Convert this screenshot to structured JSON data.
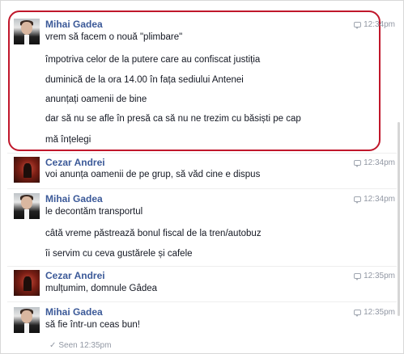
{
  "messages": [
    {
      "sender": "Mihai Gadea",
      "avatar": "mihai-gadea-avatar",
      "time": "12:34pm",
      "lines": [
        "vrem să facem o nouă \"plimbare\"",
        "împotriva celor de la putere care au confiscat justiția",
        "duminică de la ora 14.00 în fața sediului Antenei",
        "anunțați oamenii de bine",
        "dar să nu se afle în presă ca să nu ne trezim cu băsiști pe cap",
        "mă înțelegi"
      ]
    },
    {
      "sender": "Cezar Andrei",
      "avatar": "cezar-andrei-avatar",
      "time": "12:34pm",
      "lines": [
        "voi anunța oamenii de pe grup, să văd cine e dispus"
      ]
    },
    {
      "sender": "Mihai Gadea",
      "avatar": "mihai-gadea-avatar",
      "time": "12:34pm",
      "lines": [
        "le decontăm transportul",
        "câtă vreme păstrează bonul fiscal de la tren/autobuz",
        "îi servim cu ceva gustărele și cafele"
      ]
    },
    {
      "sender": "Cezar Andrei",
      "avatar": "cezar-andrei-avatar",
      "time": "12:35pm",
      "lines": [
        "mulțumim, domnule Gâdea"
      ]
    },
    {
      "sender": "Mihai Gadea",
      "avatar": "mihai-gadea-avatar",
      "time": "12:35pm",
      "lines": [
        "să fie într-un ceas bun!"
      ]
    }
  ],
  "seen": {
    "check": "✓",
    "label": "Seen 12:35pm"
  },
  "colors": {
    "highlight": "#c0172b",
    "name": "#3b5998",
    "timestamp": "#9197a3"
  }
}
